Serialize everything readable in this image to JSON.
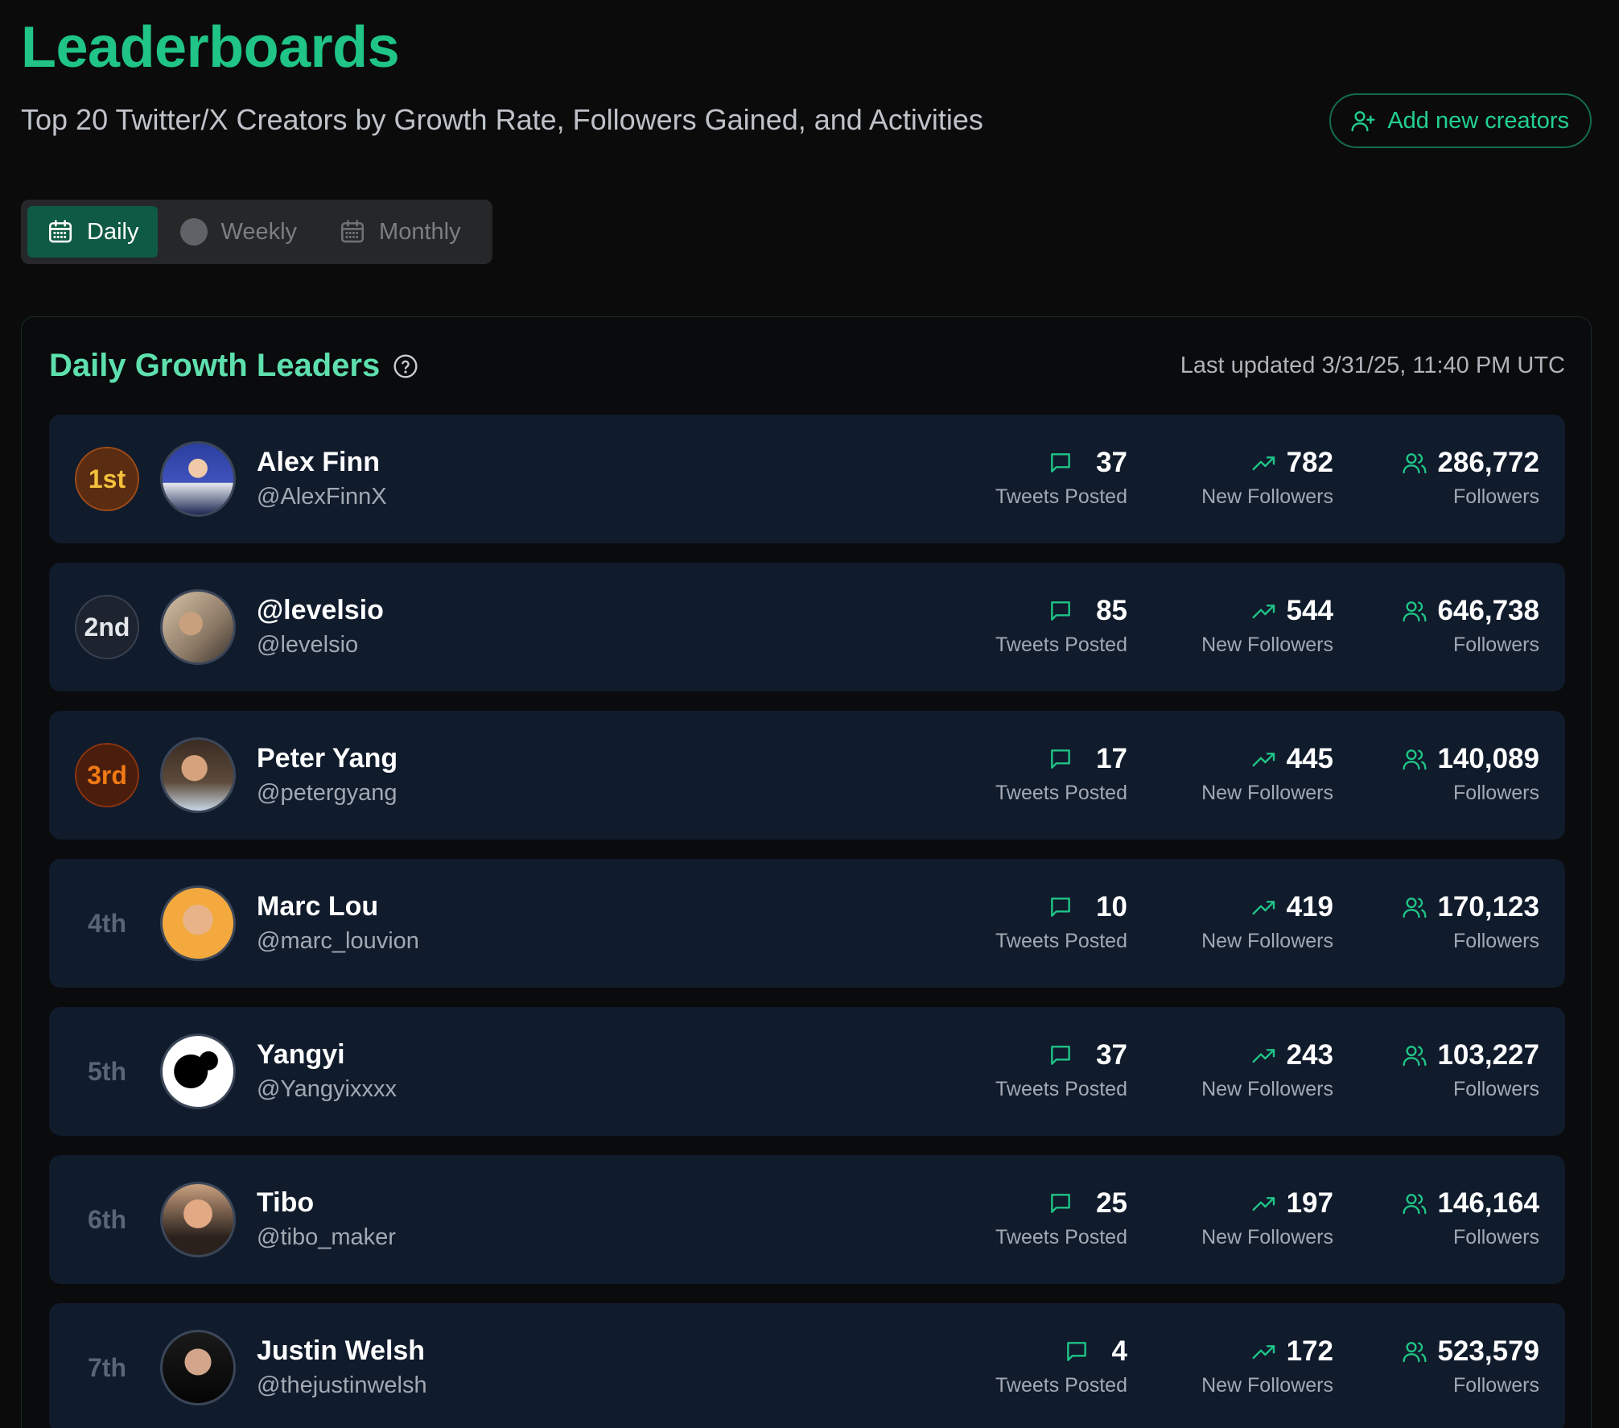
{
  "header": {
    "title": "Leaderboards",
    "subtitle": "Top 20 Twitter/X Creators by Growth Rate, Followers Gained, and Activities",
    "add_button": "Add new creators"
  },
  "tabs": [
    {
      "label": "Daily",
      "icon": "calendar-icon",
      "active": true
    },
    {
      "label": "Weekly",
      "icon": "circle-icon",
      "active": false
    },
    {
      "label": "Monthly",
      "icon": "calendar-icon",
      "active": false
    }
  ],
  "panel": {
    "title": "Daily Growth Leaders",
    "last_updated": "Last updated 3/31/25, 11:40 PM UTC"
  },
  "labels": {
    "tweets": "Tweets Posted",
    "new_followers": "New Followers",
    "followers": "Followers"
  },
  "colors": {
    "accent": "#1fc486",
    "gold": "#f4c13c",
    "silver": "#e5e7eb",
    "bronze": "#f07a14",
    "row_bg": "#101b2c"
  },
  "creators": [
    {
      "rank": "1st",
      "name": "Alex Finn",
      "handle": "@AlexFinnX",
      "tweets": "37",
      "new_followers": "782",
      "followers": "286,772"
    },
    {
      "rank": "2nd",
      "name": "@levelsio",
      "handle": "@levelsio",
      "tweets": "85",
      "new_followers": "544",
      "followers": "646,738"
    },
    {
      "rank": "3rd",
      "name": "Peter Yang",
      "handle": "@petergyang",
      "tweets": "17",
      "new_followers": "445",
      "followers": "140,089"
    },
    {
      "rank": "4th",
      "name": "Marc Lou",
      "handle": "@marc_louvion",
      "tweets": "10",
      "new_followers": "419",
      "followers": "170,123"
    },
    {
      "rank": "5th",
      "name": "Yangyi",
      "handle": "@Yangyixxxx",
      "tweets": "37",
      "new_followers": "243",
      "followers": "103,227"
    },
    {
      "rank": "6th",
      "name": "Tibo",
      "handle": "@tibo_maker",
      "tweets": "25",
      "new_followers": "197",
      "followers": "146,164"
    },
    {
      "rank": "7th",
      "name": "Justin Welsh",
      "handle": "@thejustinwelsh",
      "tweets": "4",
      "new_followers": "172",
      "followers": "523,579"
    }
  ]
}
